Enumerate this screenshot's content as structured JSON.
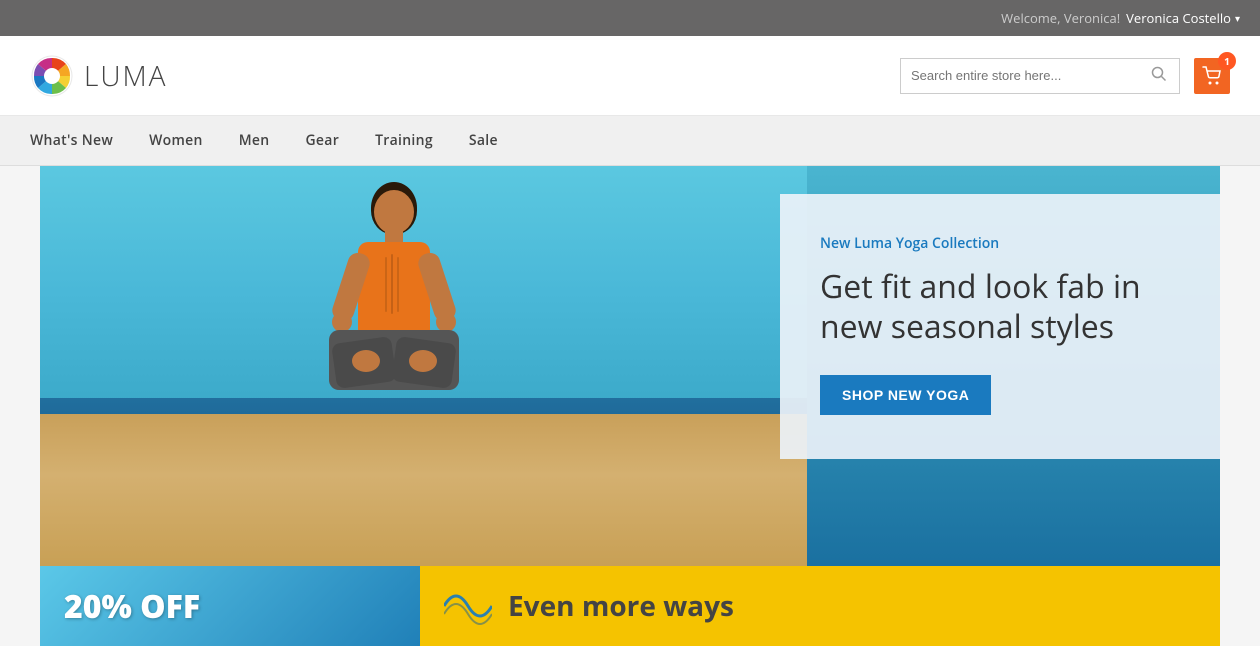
{
  "topbar": {
    "welcome_text": "Welcome, Veronica!",
    "user_name": "Veronica Costello",
    "chevron": "▾"
  },
  "header": {
    "logo_text": "LUMA",
    "search_placeholder": "Search entire store here...",
    "cart_count": "1"
  },
  "nav": {
    "items": [
      {
        "label": "What's New",
        "id": "whats-new"
      },
      {
        "label": "Women",
        "id": "women"
      },
      {
        "label": "Men",
        "id": "men"
      },
      {
        "label": "Gear",
        "id": "gear"
      },
      {
        "label": "Training",
        "id": "training"
      },
      {
        "label": "Sale",
        "id": "sale"
      }
    ]
  },
  "hero": {
    "subtitle": "New Luma Yoga Collection",
    "title": "Get fit and look fab in new seasonal styles",
    "cta_label": "Shop New Yoga"
  },
  "bottom_banners": {
    "left_text": "20% OFF",
    "right_text": "Even more ways"
  }
}
